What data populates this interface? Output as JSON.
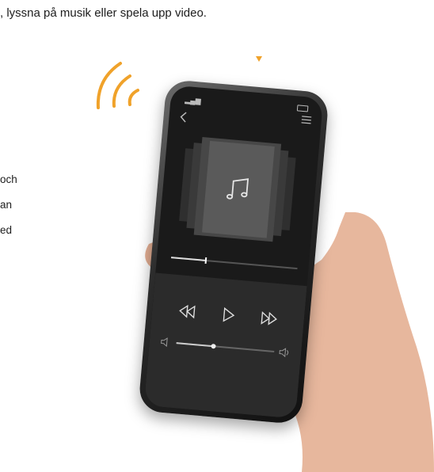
{
  "document": {
    "top_line": ", lyssna på musik eller spela upp video.",
    "side_lines": [
      "och",
      "an",
      "ed"
    ]
  },
  "colors": {
    "accent": "#f0a22a",
    "screen_bg": "#1a1a1a",
    "controls_bg": "#2b2b2b"
  },
  "player": {
    "status": {
      "signal_icon": "signal-icon",
      "battery_icon": "battery-icon"
    },
    "nav": {
      "back_icon": "chevron-left-icon",
      "menu_icon": "menu-lines-icon"
    },
    "album_art_icon": "music-note-icon",
    "playback_progress": 0.27,
    "controls": [
      "rewind-icon",
      "play-icon",
      "fast-forward-icon"
    ],
    "volume_level": 0.38
  }
}
